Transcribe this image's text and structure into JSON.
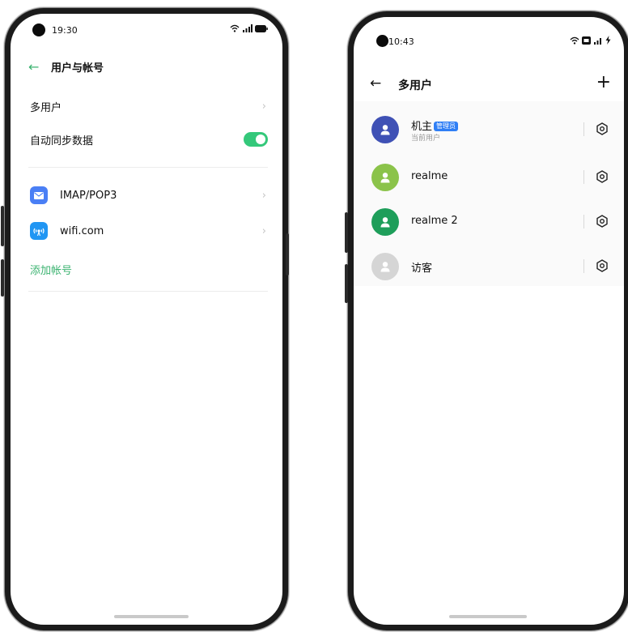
{
  "left_phone": {
    "status_bar": {
      "time": "19:30",
      "icons": [
        "wifi-icon",
        "signal-icon",
        "battery-icon"
      ]
    },
    "header": {
      "back_icon": "←",
      "title": "用户与帐号"
    },
    "settings": [
      {
        "label": "多用户",
        "chevron": "›"
      },
      {
        "label": "自动同步数据",
        "toggle_on": true
      }
    ],
    "accounts": [
      {
        "label": "IMAP/POP3",
        "icon": "mail-icon",
        "chevron": "›",
        "color": "#4a7ff5"
      },
      {
        "label": "wifi.com",
        "icon": "wifi-account-icon",
        "chevron": "›",
        "color": "#2196f3"
      }
    ],
    "add_account": "添加帐号",
    "accent": "#3cb371",
    "toggle_color": "#34c87a"
  },
  "right_phone": {
    "status_bar": {
      "time": "10:43",
      "icons": [
        "wifi-icon",
        "hd-icon",
        "signal-icon",
        "charging-icon"
      ]
    },
    "header": {
      "back_icon": "←",
      "title": "多用户",
      "add_icon": "+"
    },
    "users": [
      {
        "name": "机主",
        "badge": "管理员",
        "subtitle": "当前用户",
        "avatar_color": "#3f51b5"
      },
      {
        "name": "realme",
        "avatar_color": "#8bc34a"
      },
      {
        "name": "realme 2",
        "avatar_color": "#1e9e5a"
      },
      {
        "name": "访客",
        "avatar_color": "#d5d5d5"
      }
    ]
  }
}
